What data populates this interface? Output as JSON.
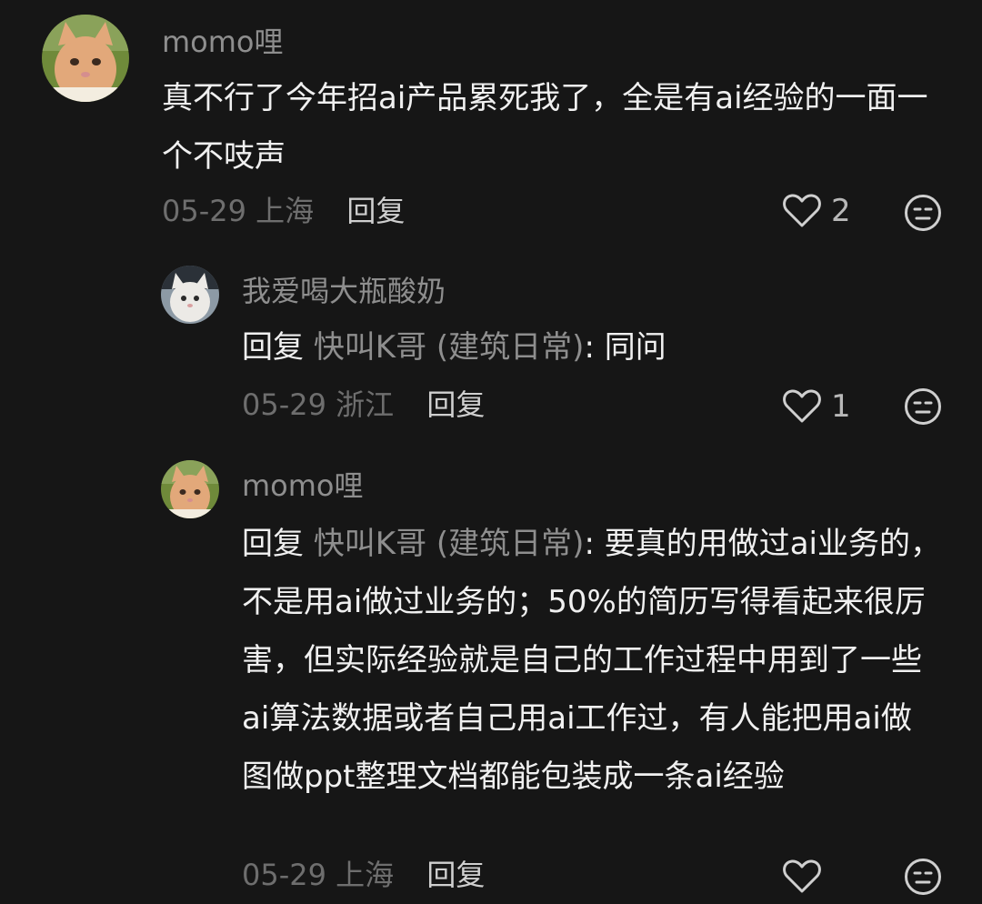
{
  "comments": [
    {
      "username": "momo哩",
      "content": "真不行了今年招ai产品累死我了，全是有ai经验的一面一个不吱声",
      "date": "05-29",
      "location": "上海",
      "reply_label": "回复",
      "likes": "2",
      "avatar_icon": "orange-cat-avatar"
    },
    {
      "username": "我爱喝大瓶酸奶",
      "reply_prefix": "回复",
      "reply_target": "快叫K哥 (建筑日常)",
      "content": "同问",
      "date": "05-29",
      "location": "浙江",
      "reply_label": "回复",
      "likes": "1",
      "avatar_icon": "white-cat-avatar"
    },
    {
      "username": "momo哩",
      "reply_prefix": "回复",
      "reply_target": "快叫K哥 (建筑日常)",
      "content": "要真的用做过ai业务的，不是用ai做过业务的；50%的简历写得看起来很厉害，但实际经验就是自己的工作过程中用到了一些ai算法数据或者自己用ai工作过，有人能把用ai做图做ppt整理文档都能包装成一条ai经验",
      "date": "05-29",
      "location": "上海",
      "reply_label": "回复",
      "likes": "",
      "avatar_icon": "orange-cat-avatar"
    }
  ],
  "colors": {
    "background": "#161616",
    "username": "#8e8e8e",
    "text": "#f0f0f0",
    "meta": "#6e6e6e"
  }
}
